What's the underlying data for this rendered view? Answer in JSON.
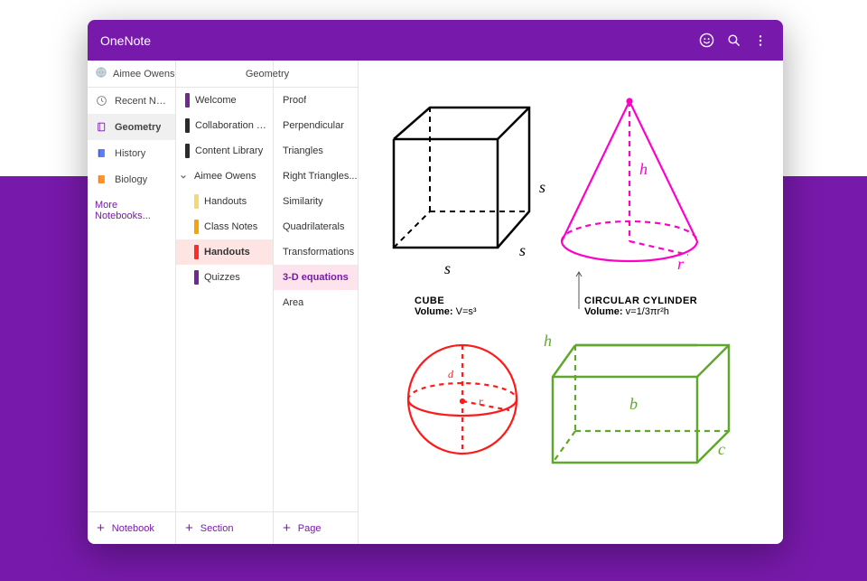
{
  "app": {
    "title": "OneNote"
  },
  "notebooks": {
    "header": "Aimee Owens",
    "items": [
      {
        "icon": "clock-icon",
        "label": "Recent Notes"
      },
      {
        "icon": "book-purple-icon",
        "label": "Geometry",
        "selected": true
      },
      {
        "icon": "book-blue-icon",
        "label": "History"
      },
      {
        "icon": "book-orange-icon",
        "label": "Biology"
      }
    ],
    "more": "More Notebooks...",
    "footer": "Notebook"
  },
  "sections": {
    "header": "Geometry",
    "items": [
      {
        "label": "Welcome",
        "color": "#722891"
      },
      {
        "label": "Collaboration Sp...",
        "color": "#2b2b2b"
      },
      {
        "label": "Content Library",
        "color": "#2b2b2b"
      },
      {
        "label": "Aimee Owens",
        "color": "#2b2b2b",
        "chevron": true
      },
      {
        "label": "Handouts",
        "color": "#f7d774",
        "indent": true
      },
      {
        "label": "Class Notes",
        "color": "#f7a400",
        "indent": true
      },
      {
        "label": "Handouts",
        "color": "#ff2a2a",
        "indent": true,
        "selected": true
      },
      {
        "label": "Quizzes",
        "color": "#722891",
        "indent": true
      }
    ],
    "footer": "Section"
  },
  "pages": {
    "items": [
      {
        "label": "Proof"
      },
      {
        "label": "Perpendicular"
      },
      {
        "label": "Triangles"
      },
      {
        "label": "Right Triangles..."
      },
      {
        "label": "Similarity"
      },
      {
        "label": "Quadrilaterals"
      },
      {
        "label": "Transformations"
      },
      {
        "label": "3-D equations",
        "selected": true
      },
      {
        "label": "Area"
      }
    ],
    "footer": "Page"
  },
  "canvas": {
    "cube": {
      "title": "CUBE",
      "formula_label": "Volume:",
      "formula": "V=s³",
      "s": "s"
    },
    "cone": {
      "title": "CIRCULAR CYLINDER",
      "formula_label": "Volume:",
      "formula": "v=1/3πr²h",
      "h": "h",
      "r": "r"
    },
    "sphere": {
      "d": "d",
      "r": "r"
    },
    "prism": {
      "h": "h",
      "b": "b",
      "c": "c"
    }
  }
}
